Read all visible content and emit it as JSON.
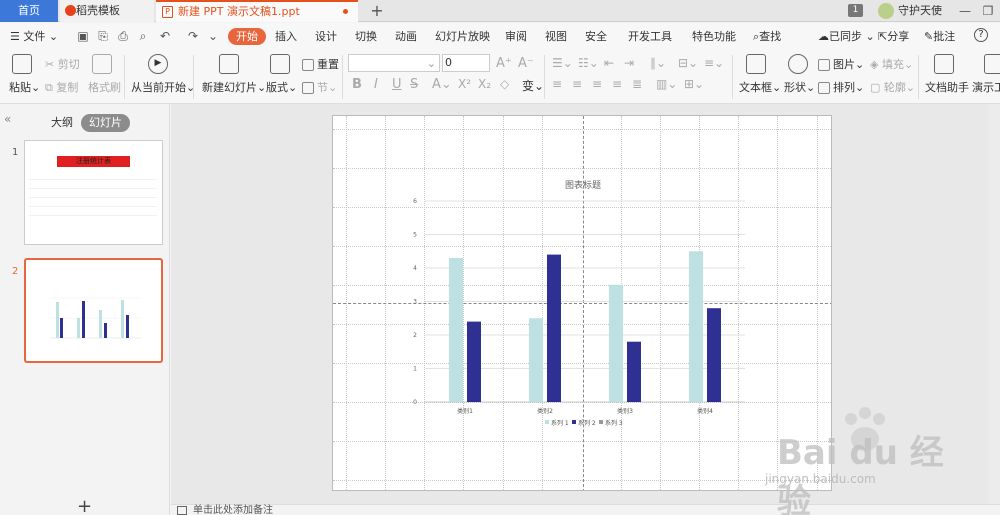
{
  "tabs": {
    "home": "首页",
    "templates": "稻壳模板",
    "document": "新建 PPT 演示文稿1.ppt",
    "new_tab": "+"
  },
  "titlebar": {
    "badge": "1",
    "user": "守护天使"
  },
  "menu": {
    "file": "文件",
    "items": [
      "开始",
      "插入",
      "设计",
      "切换",
      "动画",
      "幻灯片放映",
      "审阅",
      "视图",
      "安全",
      "开发工具",
      "特色功能"
    ],
    "search": "查找",
    "sync": "已同步",
    "share": "分享",
    "comment": "批注",
    "help": "?"
  },
  "ribbon": {
    "paste": "粘贴",
    "cut": "剪切",
    "copy": "复制",
    "format_painter": "格式刷",
    "play_from_current": "从当前开始",
    "new_slide": "新建幻灯片",
    "layout": "版式",
    "reset": "重置",
    "section": "节",
    "font_size": "0",
    "textbox": "文本框",
    "shape": "形状",
    "picture": "图片",
    "arrange": "排列",
    "fill": "填充",
    "outline": "轮廓",
    "doc_assistant": "文档助手",
    "presentation_tools": "演示工"
  },
  "left_panel": {
    "outline_tab": "大纲",
    "slides_tab": "幻灯片",
    "slide_numbers": [
      "1",
      "2"
    ],
    "slide1_title": "注册统计表",
    "add_slide": "+"
  },
  "notes": {
    "placeholder": "单击此处添加备注"
  },
  "watermark": {
    "logo": "Bai du 经验",
    "url": "jingyan.baidu.com"
  },
  "chart_data": {
    "type": "bar",
    "title": "图表标题",
    "categories": [
      "类别1",
      "类别2",
      "类别3",
      "类别4"
    ],
    "series": [
      {
        "name": "系列 1",
        "values": [
          4.3,
          2.5,
          3.5,
          4.5
        ],
        "color": "#bde0e3"
      },
      {
        "name": "系列 2",
        "values": [
          2.4,
          4.4,
          1.8,
          2.8
        ],
        "color": "#2e3192"
      },
      {
        "name": "系列 3",
        "values": [
          0,
          0,
          0,
          0
        ],
        "color": "#999999"
      }
    ],
    "ylim": [
      0,
      6
    ],
    "yticks": [
      "0",
      "1",
      "2",
      "3",
      "4",
      "5",
      "6"
    ],
    "grid": true,
    "legend": "bottom"
  }
}
